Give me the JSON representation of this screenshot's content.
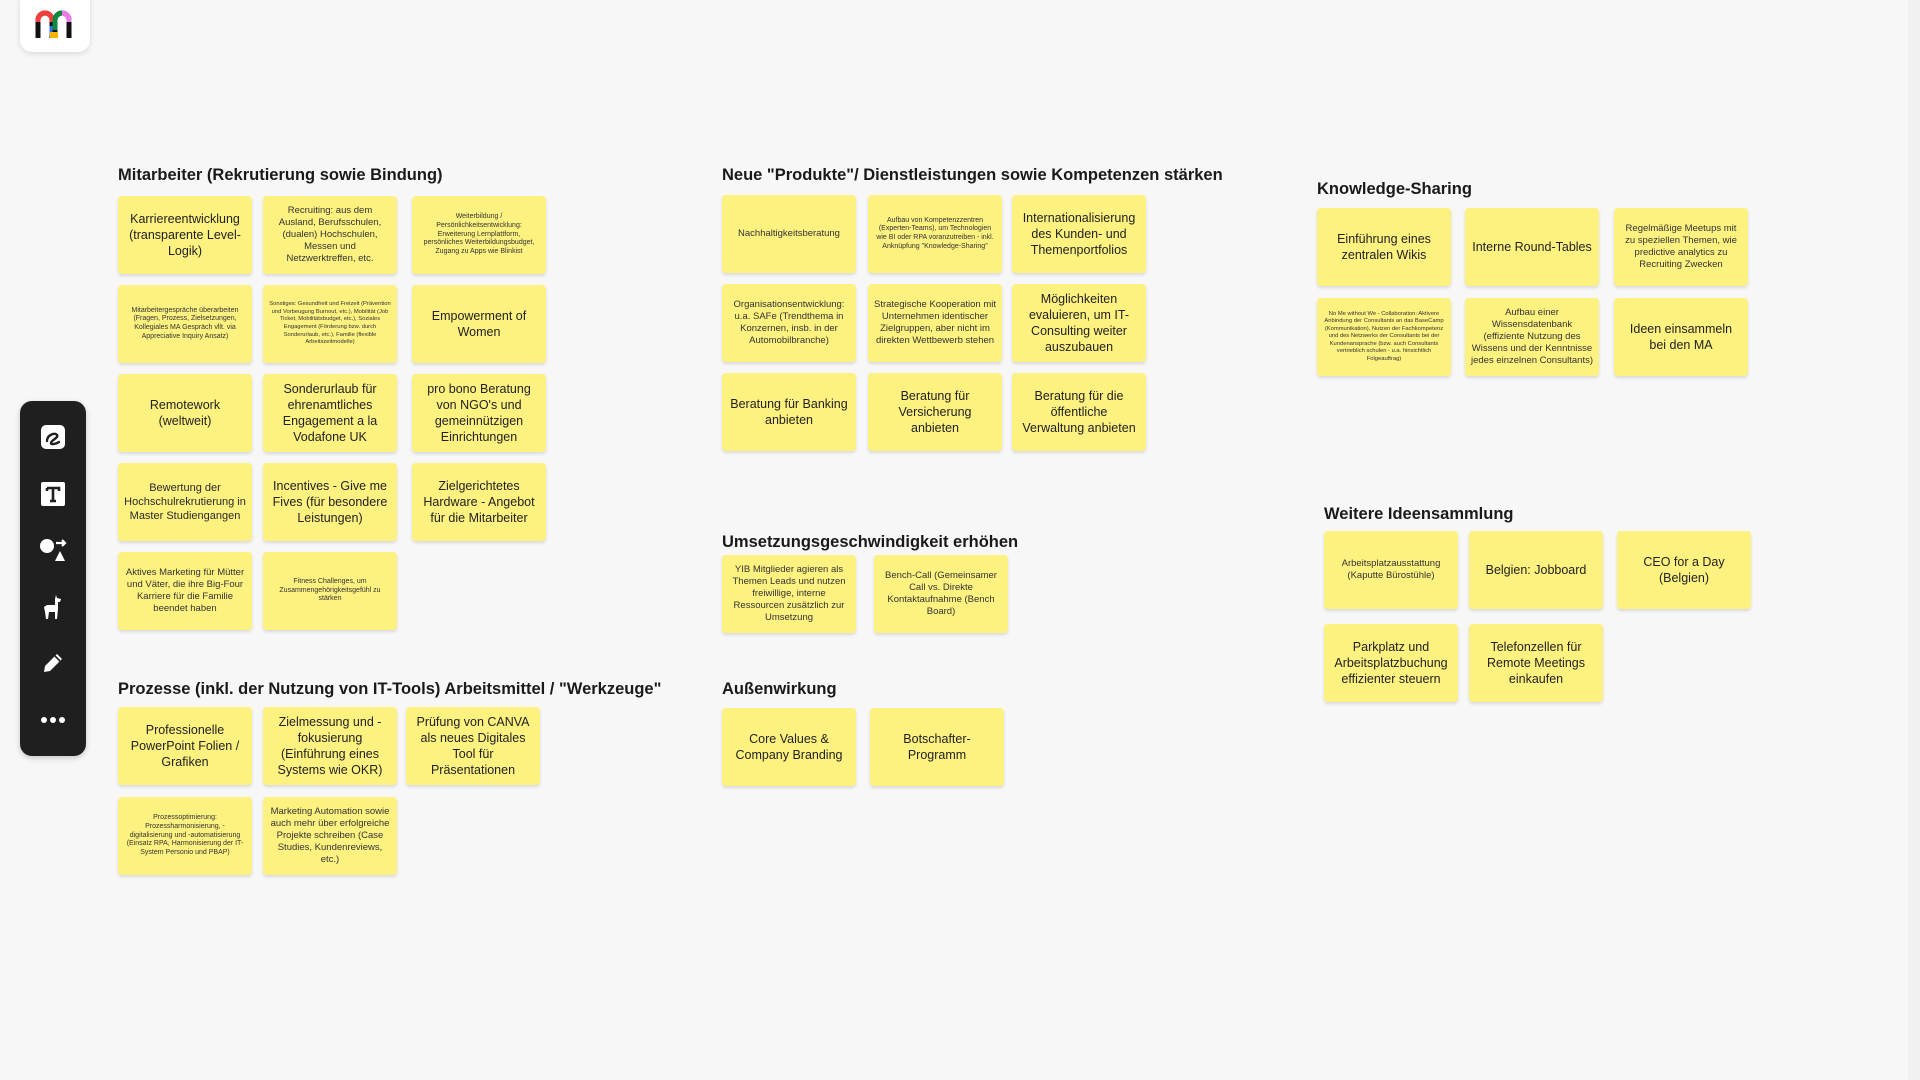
{
  "app": {
    "logo": "miro-logo",
    "toolbar": [
      {
        "name": "sticky-note-tool",
        "icon": "sticky-note-icon"
      },
      {
        "name": "text-tool",
        "icon": "text-icon"
      },
      {
        "name": "shapes-tool",
        "icon": "shapes-icon"
      },
      {
        "name": "templates-tool",
        "icon": "llama-icon"
      },
      {
        "name": "pen-tool",
        "icon": "pen-icon"
      },
      {
        "name": "more-tools",
        "icon": "more-icon"
      }
    ]
  },
  "colors": {
    "sticky": "#fdf180",
    "toolbar": "#1f1f1f",
    "canvas": "#f7f7f7"
  },
  "board": {
    "mitarbeiter": {
      "title": "Mitarbeiter (Rekrutierung sowie Bindung)",
      "notes": [
        "Karriereentwicklung (transparente Level-Logik)",
        "Recruiting: aus dem Ausland, Berufsschulen, (dualen) Hochschulen, Messen und Netzwerktreffen, etc.",
        "Weiterbildung / Persönlichkeitsentwicklung: Erweiterung Lernplattform, persönliches Weiterbildungsbudget, Zugang zu Apps wie Blinkist",
        "Mitarbeitergespräche überarbeiten (Fragen, Prozess, Zielsetzungen, Kollegiales MA Gespräch vllt. via Appreciative Inquiry Ansatz)",
        "Sonstiges: Gesundheit und Freizeit (Prävention und Vorbeugung Burnout, etc.), Mobilität (Job Ticket, Mobilitätsbudget, etc.), Soziales Engagement (Förderung bzw. durch Sonderurlaub, etc.), Familie (flexible Arbeitszeitmodelle)",
        "Empowerment of Women",
        "Remotework (weltweit)",
        "Sonderurlaub für ehrenamtliches Engagement a la Vodafone UK",
        "pro bono Beratung von NGO's und gemeinnützigen Einrichtungen",
        "Bewertung der Hochschulrekrutierung in Master Studiengangen",
        "Incentives - Give me Fives (für besondere Leistungen)",
        "Zielgerichtetes Hardware - Angebot für die Mitarbeiter",
        "Aktives Marketing für Mütter und Väter, die ihre Big-Four Karriere für die Familie beendet haben",
        "Fitness Challenges, um Zusammengehörigkeitsgefühl zu stärken"
      ]
    },
    "prozesse": {
      "title": "Prozesse (inkl. der Nutzung von IT-Tools) Arbeitsmittel / \"Werkzeuge\"",
      "notes": [
        "Professionelle PowerPoint Folien / Grafiken",
        "Zielmessung und -fokusierung (Einführung eines Systems wie OKR)",
        "Prüfung von CANVA als neues Digitales Tool für Präsentationen",
        "Prozessoptimierung: Prozessharmonisierung, -digitalisierung und -automatisierung (Einsatz RPA, Harmonisierung der IT-System Personio und PBAP)",
        "Marketing Automation sowie auch mehr über erfolgreiche Projekte schreiben (Case Studies, Kundenreviews, etc.)"
      ]
    },
    "produkte": {
      "title": "Neue \"Produkte\"/ Dienstleistungen sowie Kompetenzen stärken",
      "notes": [
        "Nachhaltigkeitsberatung",
        "Aufbau von Kompetenzzentren (Experten-Teams), um Technologien wie BI oder RPA voranzutreiben - inkl. Anknüpfung \"Knowledge-Sharing\"",
        "Internationalisierung des Kunden- und Themenportfolios",
        "Organisationsentwicklung: u.a. SAFe (Trendthema in Konzernen, insb. in der Automobilbranche)",
        "Strategische Kooperation mit Unternehmen identischer Zielgruppen, aber nicht im direkten Wettbewerb stehen",
        "Möglichkeiten evaluieren, um IT-Consulting weiter auszubauen",
        "Beratung für Banking anbieten",
        "Beratung für Versicherung anbieten",
        "Beratung für die öffentliche Verwaltung anbieten"
      ]
    },
    "umsetzung": {
      "title": "Umsetzungsgeschwindigkeit erhöhen",
      "notes": [
        "YIB Mitglieder agieren als Themen Leads und nutzen freiwillige, interne Ressourcen zusätzlich zur Umsetzung",
        "Bench-Call (Gemeinsamer Call vs. Direkte Kontaktaufnahme (Bench Board)"
      ]
    },
    "aussen": {
      "title": "Außenwirkung",
      "notes": [
        "Core Values & Company Branding",
        "Botschafter-Programm"
      ]
    },
    "knowledge": {
      "title": "Knowledge-Sharing",
      "notes": [
        "Einführung eines zentralen Wikis",
        "Interne Round-Tables",
        "Regelmäßige Meetups mit zu speziellen Themen, wie predictive analytics zu Recruiting Zwecken",
        "No Me without We - Collaboration: Aktivere Anbindung der Consultants an das BaseCamp (Kommunikation), Nutzen der Fachkompetenz und des Netzwerks der Consultants bei der Kundenansprache (bzw. auch Consultants vertrieblich schulen - u.a. hinsichtlich Folgeauftrag)",
        "Aufbau einer Wissensdatenbank (effiziente Nutzung des Wissens und der Kenntnisse jedes einzelnen Consultants)",
        "Ideen einsammeln bei den MA"
      ]
    },
    "weitere": {
      "title": "Weitere Ideensammlung",
      "notes": [
        "Arbeitsplatzausstattung (Kaputte Bürostühle)",
        "Belgien: Jobboard",
        "CEO for a Day (Belgien)",
        "Parkplatz und Arbeitsplatzbuchung effizienter steuern",
        "Telefonzellen für Remote Meetings einkaufen"
      ]
    }
  }
}
